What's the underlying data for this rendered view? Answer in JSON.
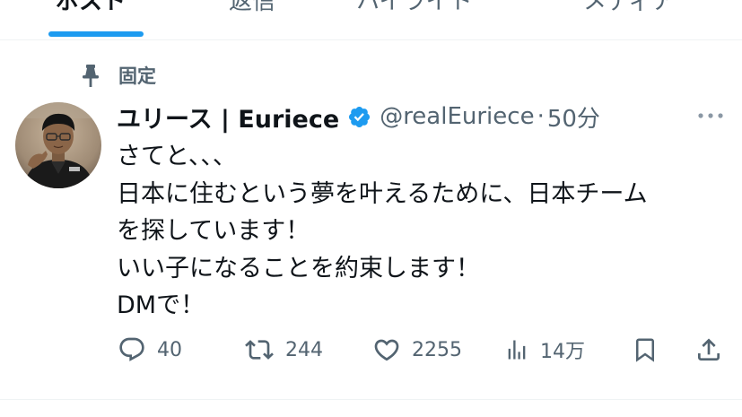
{
  "tabs": [
    {
      "label": "ポスト",
      "active": true
    },
    {
      "label": "返信",
      "active": false
    },
    {
      "label": "ハイライト",
      "active": false
    },
    {
      "label": "メディア",
      "active": false
    }
  ],
  "pinned": {
    "icon": "pin-icon",
    "label": "固定"
  },
  "tweet": {
    "author": {
      "display_name": "ユリース | Euriece",
      "verified": true,
      "verified_icon": "verified-badge-icon",
      "handle": "@realEuriece",
      "separator": "·",
      "time": "50分"
    },
    "lines": [
      "さてと、、、",
      "日本に住むという夢を叶えるために、日本チーム",
      "を探しています！",
      "いい子になることを約束します！",
      "DMで！"
    ],
    "stats": {
      "replies": "40",
      "reposts": "244",
      "likes": "2255",
      "views": "14万"
    }
  },
  "icons": {
    "reply": "reply-icon",
    "repost": "repost-icon",
    "like": "heart-icon",
    "views": "views-chart-icon",
    "bookmark": "bookmark-icon",
    "share": "share-icon",
    "more": "more-icon"
  },
  "colors": {
    "accent": "#1d9bf0",
    "text_primary": "#0f1419",
    "text_secondary": "#536471",
    "divider": "#eff3f4"
  }
}
